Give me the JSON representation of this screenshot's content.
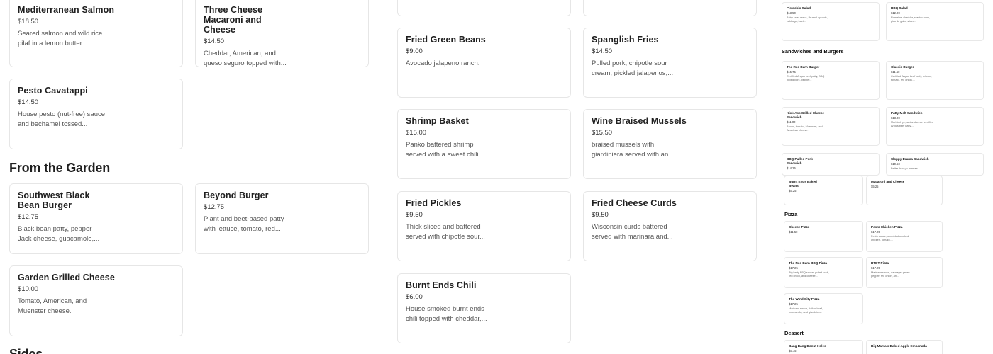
{
  "col1": {
    "salmon": {
      "name": "Mediterranean Salmon",
      "price": "$18.50",
      "desc": "Seared salmon and wild rice pilaf in a lemon butter..."
    },
    "pesto": {
      "name": "Pesto Cavatappi",
      "price": "$14.50",
      "desc": "House pesto (nut-free) sauce and bechamel tossed..."
    },
    "garden_title": "From the Garden",
    "southwest": {
      "name": "Southwest Black Bean Burger",
      "price": "$12.75",
      "desc": "Black bean patty, pepper Jack cheese, guacamole,..."
    },
    "grilled": {
      "name": "Garden Grilled Cheese",
      "price": "$10.00",
      "desc": "Tomato, American, and Muenster cheese."
    },
    "sides_title": "Sides"
  },
  "col2": {
    "mac": {
      "name": "Three Cheese Macaroni and Cheese",
      "price": "$14.50",
      "desc": "Cheddar, American, and queso seguro topped with..."
    },
    "beyond": {
      "name": "Beyond Burger",
      "price": "$12.75",
      "desc": "Plant and beet-based patty with lettuce, tomato, red..."
    }
  },
  "col3": {
    "greenbeans": {
      "name": "Fried Green Beans",
      "price": "$9.00",
      "desc": "Avocado jalapeno ranch."
    },
    "shrimp": {
      "name": "Shrimp Basket",
      "price": "$15.00",
      "desc": "Panko battered shrimp served with a sweet chili..."
    },
    "pickles": {
      "name": "Fried Pickles",
      "price": "$9.50",
      "desc": "Thick sliced and battered served with chipotle sour..."
    },
    "chili": {
      "name": "Burnt Ends Chili",
      "price": "$6.00",
      "desc": "House smoked burnt ends chili topped with cheddar,..."
    }
  },
  "col4": {
    "spanglish": {
      "name": "Spanglish Fries",
      "price": "$14.50",
      "desc": "Pulled pork, chipotle sour cream, pickled jalapenos,..."
    },
    "mussels": {
      "name": "Wine Braised Mussels",
      "price": "$15.50",
      "desc": "braised mussels with giardiniera served with an..."
    },
    "curds": {
      "name": "Fried Cheese Curds",
      "price": "$9.50",
      "desc": "Wisconsin curds battered served with marinara and..."
    }
  },
  "preview": {
    "salads": [
      {
        "name": "Pistachio Salad",
        "price": "$13.50",
        "desc": "Baby kale, carrot, Brussel sprouts, cabbage, beet..."
      },
      {
        "name": "BBQ Salad",
        "price": "$12.00",
        "desc": "Romaine, cheddar, roasted corn, pico de gallo, sliced..."
      }
    ],
    "sandwiches_heading": "Sandwiches and Burgers",
    "sandwiches": [
      {
        "name": "The Red Barn Burger",
        "price": "$15.75",
        "desc": "Certified Angus beef patty, BBQ pulled pork, pepper..."
      },
      {
        "name": "Classic Burger",
        "price": "$11.50",
        "desc": "Certified Angus beef patty, lettuce, tomato, red onion,..."
      },
      {
        "name": "Kick-Ass Grilled Cheese Sandwich",
        "price": "$11.00",
        "desc": "Bacon, tomato, Muenster, and American cheese."
      },
      {
        "name": "Patty Melt Sandwich",
        "price": "$13.00",
        "desc": "Marbled rye, swiss cheese, certified Angus beef patty,..."
      },
      {
        "name": "BBQ Pulled Pork Sandwich",
        "price": "$14.25",
        "desc": ""
      },
      {
        "name": "Sloppy Drama Sandwich",
        "price": "$10.50",
        "desc": "Better than yo mama's."
      },
      {
        "name": "Burnt Ends Baked Beans",
        "price": "$5.25",
        "desc": ""
      },
      {
        "name": "Macaroni and Cheese",
        "price": "$5.25",
        "desc": ""
      }
    ],
    "pizza_heading": "Pizza",
    "pizzas": [
      {
        "name": "Cheese Pizza",
        "price": "$11.50",
        "desc": ""
      },
      {
        "name": "Pesto Chicken Pizza",
        "price": "$17.25",
        "desc": "Pesto sauce, shredded smoked chicken, tomato,..."
      },
      {
        "name": "The Red Barn BBQ Pizza",
        "price": "$17.25",
        "desc": "Big batty BBQ sauce, pulled pork, red onion, and cheese..."
      },
      {
        "name": "BTDT Pizza",
        "price": "$17.25",
        "desc": "Marinara sauce, sausage, green pepper, red onion, an..."
      },
      {
        "name": "The Wind City Pizza",
        "price": "$17.25",
        "desc": "Marinara sauce, Italian beef, mozzarella, and giardiniera."
      }
    ],
    "dessert_heading": "Dessert",
    "desserts": [
      {
        "name": "Bang Bang Donut Holes",
        "price": "$5.75",
        "desc": ""
      },
      {
        "name": "Big Mama's Baked Apple Empanada",
        "price": "",
        "desc": ""
      }
    ]
  }
}
